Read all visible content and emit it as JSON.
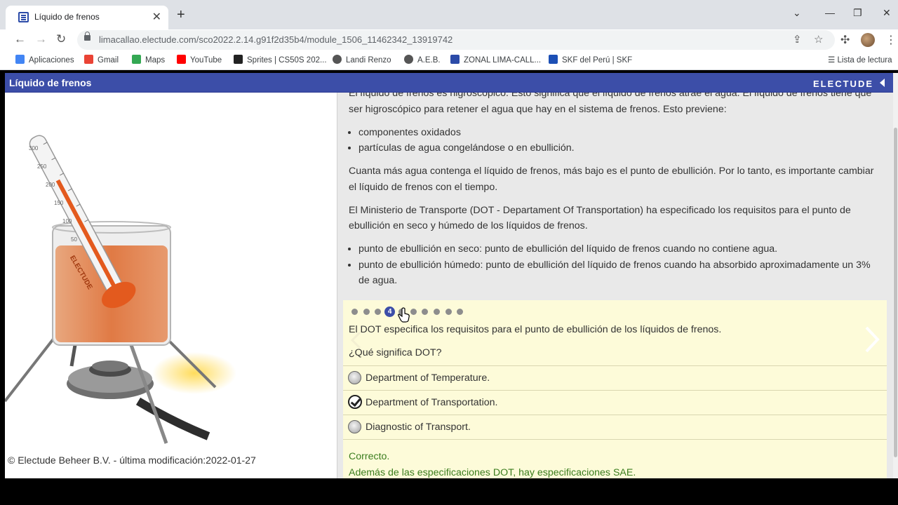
{
  "browser": {
    "tab_title": "Líquido de frenos",
    "url": "limacallao.electude.com/sco2022.2.14.g91f2d35b4/module_1506_11462342_13919742",
    "bookmarks": [
      {
        "label": "Aplicaciones",
        "icon": "apps-grid-icon",
        "color": "#4285f4"
      },
      {
        "label": "Gmail",
        "icon": "gmail-icon",
        "color": "#ea4335"
      },
      {
        "label": "Maps",
        "icon": "maps-pin-icon",
        "color": "#34a853"
      },
      {
        "label": "YouTube",
        "icon": "youtube-icon",
        "color": "#ff0000"
      },
      {
        "label": "Sprites | CS50S 202...",
        "icon": "sprites-x-icon",
        "color": "#222222"
      },
      {
        "label": "Landi Renzo",
        "icon": "globe-icon",
        "color": "#555555"
      },
      {
        "label": "A.E.B.",
        "icon": "globe-icon",
        "color": "#555555"
      },
      {
        "label": "ZONAL LIMA-CALL...",
        "icon": "electude-icon",
        "color": "#2b4ba8"
      },
      {
        "label": "SKF del Perú | SKF",
        "icon": "skf-icon",
        "color": "#1c4fb5"
      }
    ],
    "reading_list": "Lista de lectura"
  },
  "module": {
    "title": "Líquido de frenos",
    "brand": "ELECTUDE",
    "accent_color": "#3c4ea8"
  },
  "left": {
    "copyright": "© Electude Beheer B.V. - última modificación:2022-01-27",
    "thermometer_label": "ELECTUDE",
    "scale_ticks": [
      "300",
      "250",
      "200",
      "150",
      "100",
      "50"
    ]
  },
  "content": {
    "p1": "El líquido de frenos es higroscópico. Esto significa que el líquido de frenos atrae el agua. El líquido de frenos tiene que ser higroscópico para retener el agua que hay en el sistema de frenos. Esto previene:",
    "list1": [
      "componentes oxidados",
      "partículas de agua congelándose o en ebullición."
    ],
    "p2": "Cuanta más agua contenga el líquido de frenos, más bajo es el punto de ebullición. Por lo tanto, es importante cambiar el líquido de frenos con el tiempo.",
    "p3": "El Ministerio de Transporte (DOT - Departament Of Transportation) ha especificado los requisitos para el punto de ebullición en seco y húmedo de los líquidos de frenos.",
    "list2": [
      "punto de ebullición en seco: punto de ebullición del líquido de frenos cuando no contiene agua.",
      "punto de ebullición húmedo: punto de ebullición del líquido de frenos cuando ha absorbido aproximadamente un 3% de agua."
    ]
  },
  "quiz": {
    "total_steps": 10,
    "current_step": "4",
    "statement": "El DOT especifica los requisitos para el punto de ebullición de los líquidos de frenos.",
    "question": "¿Qué significa DOT?",
    "options": [
      {
        "label": "Department of Temperature.",
        "selected": false
      },
      {
        "label": "Department of Transportation.",
        "selected": true
      },
      {
        "label": "Diagnostic of Transport.",
        "selected": false
      }
    ],
    "feedback_title": "Correcto.",
    "feedback_text": "Además de las especificaciones DOT, hay especificaciones SAE.",
    "feedback_color": "#3b7d1e"
  }
}
